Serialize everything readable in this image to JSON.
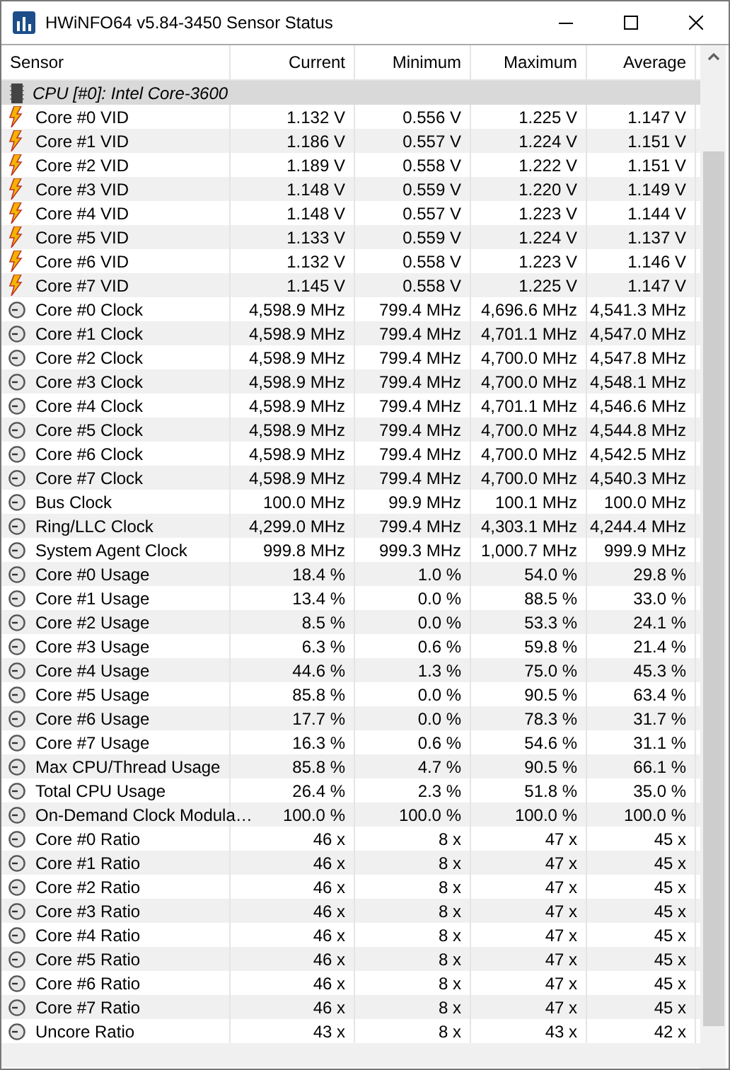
{
  "window": {
    "title": "HWiNFO64 v5.84-3450 Sensor Status"
  },
  "columns": [
    "Sensor",
    "Current",
    "Minimum",
    "Maximum",
    "Average"
  ],
  "group": {
    "label": "CPU [#0]: Intel Core-3600"
  },
  "rows": [
    {
      "kind": "voltage",
      "name": "Core #0 VID",
      "values": [
        "1.132 V",
        "0.556 V",
        "1.225 V",
        "1.147 V"
      ]
    },
    {
      "kind": "voltage",
      "name": "Core #1 VID",
      "values": [
        "1.186 V",
        "0.557 V",
        "1.224 V",
        "1.151 V"
      ]
    },
    {
      "kind": "voltage",
      "name": "Core #2 VID",
      "values": [
        "1.189 V",
        "0.558 V",
        "1.222 V",
        "1.151 V"
      ]
    },
    {
      "kind": "voltage",
      "name": "Core #3 VID",
      "values": [
        "1.148 V",
        "0.559 V",
        "1.220 V",
        "1.149 V"
      ]
    },
    {
      "kind": "voltage",
      "name": "Core #4 VID",
      "values": [
        "1.148 V",
        "0.557 V",
        "1.223 V",
        "1.144 V"
      ]
    },
    {
      "kind": "voltage",
      "name": "Core #5 VID",
      "values": [
        "1.133 V",
        "0.559 V",
        "1.224 V",
        "1.137 V"
      ]
    },
    {
      "kind": "voltage",
      "name": "Core #6 VID",
      "values": [
        "1.132 V",
        "0.558 V",
        "1.223 V",
        "1.146 V"
      ]
    },
    {
      "kind": "voltage",
      "name": "Core #7 VID",
      "values": [
        "1.145 V",
        "0.558 V",
        "1.225 V",
        "1.147 V"
      ]
    },
    {
      "kind": "gauge",
      "name": "Core #0 Clock",
      "values": [
        "4,598.9 MHz",
        "799.4 MHz",
        "4,696.6 MHz",
        "4,541.3 MHz"
      ]
    },
    {
      "kind": "gauge",
      "name": "Core #1 Clock",
      "values": [
        "4,598.9 MHz",
        "799.4 MHz",
        "4,701.1 MHz",
        "4,547.0 MHz"
      ]
    },
    {
      "kind": "gauge",
      "name": "Core #2 Clock",
      "values": [
        "4,598.9 MHz",
        "799.4 MHz",
        "4,700.0 MHz",
        "4,547.8 MHz"
      ]
    },
    {
      "kind": "gauge",
      "name": "Core #3 Clock",
      "values": [
        "4,598.9 MHz",
        "799.4 MHz",
        "4,700.0 MHz",
        "4,548.1 MHz"
      ]
    },
    {
      "kind": "gauge",
      "name": "Core #4 Clock",
      "values": [
        "4,598.9 MHz",
        "799.4 MHz",
        "4,701.1 MHz",
        "4,546.6 MHz"
      ]
    },
    {
      "kind": "gauge",
      "name": "Core #5 Clock",
      "values": [
        "4,598.9 MHz",
        "799.4 MHz",
        "4,700.0 MHz",
        "4,544.8 MHz"
      ]
    },
    {
      "kind": "gauge",
      "name": "Core #6 Clock",
      "values": [
        "4,598.9 MHz",
        "799.4 MHz",
        "4,700.0 MHz",
        "4,542.5 MHz"
      ]
    },
    {
      "kind": "gauge",
      "name": "Core #7 Clock",
      "values": [
        "4,598.9 MHz",
        "799.4 MHz",
        "4,700.0 MHz",
        "4,540.3 MHz"
      ]
    },
    {
      "kind": "gauge",
      "name": "Bus Clock",
      "values": [
        "100.0 MHz",
        "99.9 MHz",
        "100.1 MHz",
        "100.0 MHz"
      ]
    },
    {
      "kind": "gauge",
      "name": "Ring/LLC Clock",
      "values": [
        "4,299.0 MHz",
        "799.4 MHz",
        "4,303.1 MHz",
        "4,244.4 MHz"
      ]
    },
    {
      "kind": "gauge",
      "name": "System Agent Clock",
      "values": [
        "999.8 MHz",
        "999.3 MHz",
        "1,000.7 MHz",
        "999.9 MHz"
      ]
    },
    {
      "kind": "gauge",
      "name": "Core #0 Usage",
      "values": [
        "18.4 %",
        "1.0 %",
        "54.0 %",
        "29.8 %"
      ]
    },
    {
      "kind": "gauge",
      "name": "Core #1 Usage",
      "values": [
        "13.4 %",
        "0.0 %",
        "88.5 %",
        "33.0 %"
      ]
    },
    {
      "kind": "gauge",
      "name": "Core #2 Usage",
      "values": [
        "8.5 %",
        "0.0 %",
        "53.3 %",
        "24.1 %"
      ]
    },
    {
      "kind": "gauge",
      "name": "Core #3 Usage",
      "values": [
        "6.3 %",
        "0.6 %",
        "59.8 %",
        "21.4 %"
      ]
    },
    {
      "kind": "gauge",
      "name": "Core #4 Usage",
      "values": [
        "44.6 %",
        "1.3 %",
        "75.0 %",
        "45.3 %"
      ]
    },
    {
      "kind": "gauge",
      "name": "Core #5 Usage",
      "values": [
        "85.8 %",
        "0.0 %",
        "90.5 %",
        "63.4 %"
      ]
    },
    {
      "kind": "gauge",
      "name": "Core #6 Usage",
      "values": [
        "17.7 %",
        "0.0 %",
        "78.3 %",
        "31.7 %"
      ]
    },
    {
      "kind": "gauge",
      "name": "Core #7 Usage",
      "values": [
        "16.3 %",
        "0.6 %",
        "54.6 %",
        "31.1 %"
      ]
    },
    {
      "kind": "gauge",
      "name": "Max CPU/Thread Usage",
      "values": [
        "85.8 %",
        "4.7 %",
        "90.5 %",
        "66.1 %"
      ]
    },
    {
      "kind": "gauge",
      "name": "Total CPU Usage",
      "values": [
        "26.4 %",
        "2.3 %",
        "51.8 %",
        "35.0 %"
      ]
    },
    {
      "kind": "gauge",
      "name": "On-Demand Clock Modula…",
      "values": [
        "100.0 %",
        "100.0 %",
        "100.0 %",
        "100.0 %"
      ]
    },
    {
      "kind": "gauge",
      "name": "Core #0 Ratio",
      "values": [
        "46 x",
        "8 x",
        "47 x",
        "45 x"
      ]
    },
    {
      "kind": "gauge",
      "name": "Core #1 Ratio",
      "values": [
        "46 x",
        "8 x",
        "47 x",
        "45 x"
      ]
    },
    {
      "kind": "gauge",
      "name": "Core #2 Ratio",
      "values": [
        "46 x",
        "8 x",
        "47 x",
        "45 x"
      ]
    },
    {
      "kind": "gauge",
      "name": "Core #3 Ratio",
      "values": [
        "46 x",
        "8 x",
        "47 x",
        "45 x"
      ]
    },
    {
      "kind": "gauge",
      "name": "Core #4 Ratio",
      "values": [
        "46 x",
        "8 x",
        "47 x",
        "45 x"
      ]
    },
    {
      "kind": "gauge",
      "name": "Core #5 Ratio",
      "values": [
        "46 x",
        "8 x",
        "47 x",
        "45 x"
      ]
    },
    {
      "kind": "gauge",
      "name": "Core #6 Ratio",
      "values": [
        "46 x",
        "8 x",
        "47 x",
        "45 x"
      ]
    },
    {
      "kind": "gauge",
      "name": "Core #7 Ratio",
      "values": [
        "46 x",
        "8 x",
        "47 x",
        "45 x"
      ]
    },
    {
      "kind": "gauge",
      "name": "Uncore Ratio",
      "values": [
        "43 x",
        "8 x",
        "43 x",
        "42 x"
      ]
    }
  ]
}
